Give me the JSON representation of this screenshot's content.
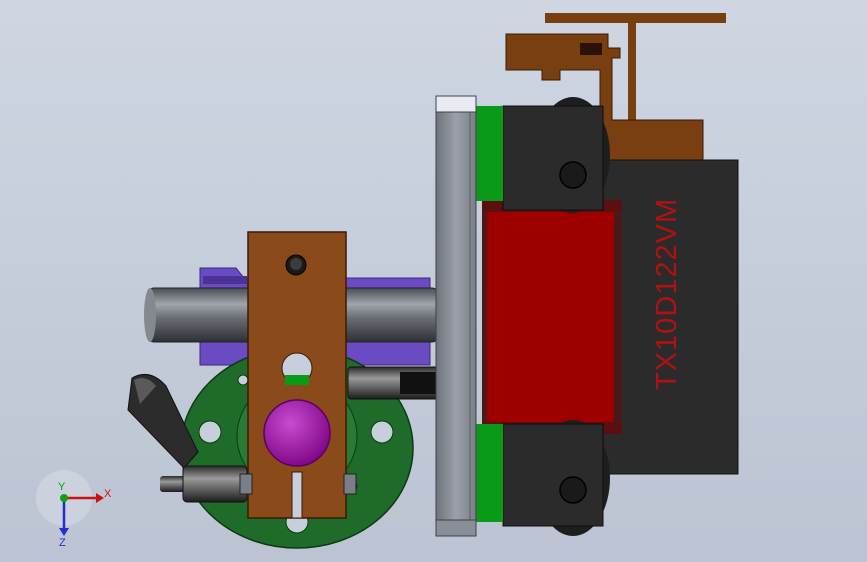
{
  "viewport": {
    "colors": {
      "background": "#c8cfdc",
      "bracket_brown": "#7a3f10",
      "plate_brown": "#8a4a1a",
      "motor_black": "#2b2b2b",
      "cylinder_red": "#9e0000",
      "guide_green": "#0a9a1a",
      "flange_green": "#1f6b2a",
      "mount_purple": "#6a4bc4",
      "knob_magenta": "#a20aa8",
      "rail_gray": "#8f949c",
      "shaft_gray": "#6d7178"
    },
    "model_label": "TX10D122VM"
  },
  "triad": {
    "x_label": "X",
    "y_label": "Y",
    "z_label": "Z",
    "x_color": "#d01010",
    "y_color": "#10a010",
    "z_color": "#2030d0"
  }
}
